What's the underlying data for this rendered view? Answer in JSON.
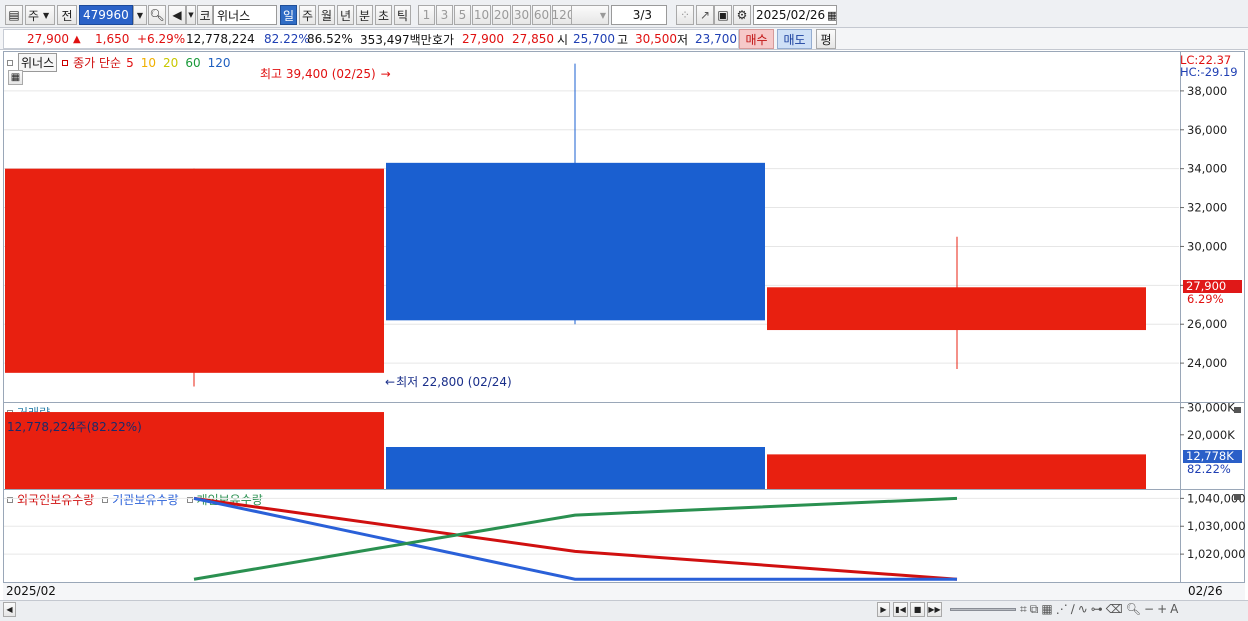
{
  "toolbar": {
    "type_select": "주",
    "prev_label": "전",
    "code_value": "479960",
    "market_label": "코",
    "stock_name": "위너스",
    "period_buttons": [
      "일",
      "주",
      "월",
      "년",
      "분",
      "초",
      "틱"
    ],
    "active_period": "일",
    "interval_buttons": [
      "1",
      "3",
      "5",
      "10",
      "20",
      "30",
      "60",
      "120"
    ],
    "page_indicator": "3/3",
    "date_value": "2025/02/26"
  },
  "quote": {
    "price": "27,900",
    "change": "1,650",
    "change_pct": "+6.29%",
    "volume": "12,778,224",
    "vol_ratio": "82.22%",
    "turnover": "86.52%",
    "trade_value": "353,497백만",
    "bid_label": "호가",
    "ask_price": "27,900",
    "bid_price": "27,850",
    "open_label": "시",
    "open": "25,700",
    "high_label": "고",
    "high": "30,500",
    "low_label": "저",
    "low": "23,700",
    "buy_label": "매수",
    "sell_label": "매도",
    "eval_label": "평"
  },
  "price_panel": {
    "stock_tag": "위너스",
    "legend_title": "종가 단순",
    "ma_periods": [
      "5",
      "10",
      "20",
      "60",
      "120"
    ],
    "ma_colors": [
      "#e01010",
      "#f0b000",
      "#c8c800",
      "#1a9a3a",
      "#2060c0"
    ],
    "lc": "LC:22.37",
    "hc": "HC:-29.19",
    "high_annotation": "최고 39,400 (02/25)",
    "low_annotation": "최저 22,800 (02/24)",
    "current_price_tag": "27,900",
    "current_pct_tag": "6.29%"
  },
  "volume_panel": {
    "title": "거래량",
    "current_label": "12,778,224주(82.22%)",
    "current_tag": "12,778K",
    "current_pct_tag": "82.22%"
  },
  "holding_panel": {
    "legend": [
      "외국인보유수량",
      "기관보유수량",
      "개인보유수량"
    ],
    "legend_colors": [
      "#d01010",
      "#2a60d8",
      "#2a9050"
    ]
  },
  "axis": {
    "start_label": "2025/02",
    "end_label": "02/26"
  },
  "chart_data": [
    {
      "type": "candlestick",
      "categories": [
        "02/24",
        "02/25",
        "02/26"
      ],
      "open": [
        23500,
        34300,
        25700
      ],
      "high": [
        34000,
        39400,
        30500
      ],
      "low": [
        22800,
        26000,
        23700
      ],
      "close": [
        34000,
        26200,
        27900
      ],
      "colors": [
        "#e82010",
        "#1a5fd0",
        "#e82010"
      ],
      "ylim": [
        22000,
        40000
      ],
      "yticks": [
        24000,
        26000,
        28000,
        30000,
        32000,
        34000,
        36000,
        38000
      ],
      "ytick_labels": [
        "24,000",
        "26,000",
        "28,000",
        "30,000",
        "32,000",
        "34,000",
        "36,000",
        "38,000"
      ]
    },
    {
      "type": "bar",
      "title": "거래량",
      "categories": [
        "02/24",
        "02/25",
        "02/26"
      ],
      "values": [
        28400,
        15500,
        12778
      ],
      "unit": "K",
      "colors": [
        "#e82010",
        "#1a5fd0",
        "#e82010"
      ],
      "ylim": [
        0,
        31000
      ],
      "yticks": [
        20000,
        30000
      ],
      "ytick_labels": [
        "20,000K",
        "30,000K"
      ]
    },
    {
      "type": "line",
      "categories": [
        "02/24",
        "02/25",
        "02/26"
      ],
      "series": [
        {
          "name": "외국인보유수량",
          "values": [
            1040000,
            1021000,
            1011000
          ],
          "color": "#d01010"
        },
        {
          "name": "기관보유수량",
          "values": [
            1040000,
            1011000,
            1011000
          ],
          "color": "#2a60d8"
        },
        {
          "name": "개인보유수량",
          "values": [
            1011000,
            1034000,
            1040000
          ],
          "color": "#2a9050"
        }
      ],
      "ylim": [
        1010000,
        1043000
      ],
      "yticks": [
        1020000,
        1030000,
        1040000
      ],
      "ytick_labels": [
        "1,020,000",
        "1,030,000",
        "1,040,000"
      ]
    }
  ]
}
